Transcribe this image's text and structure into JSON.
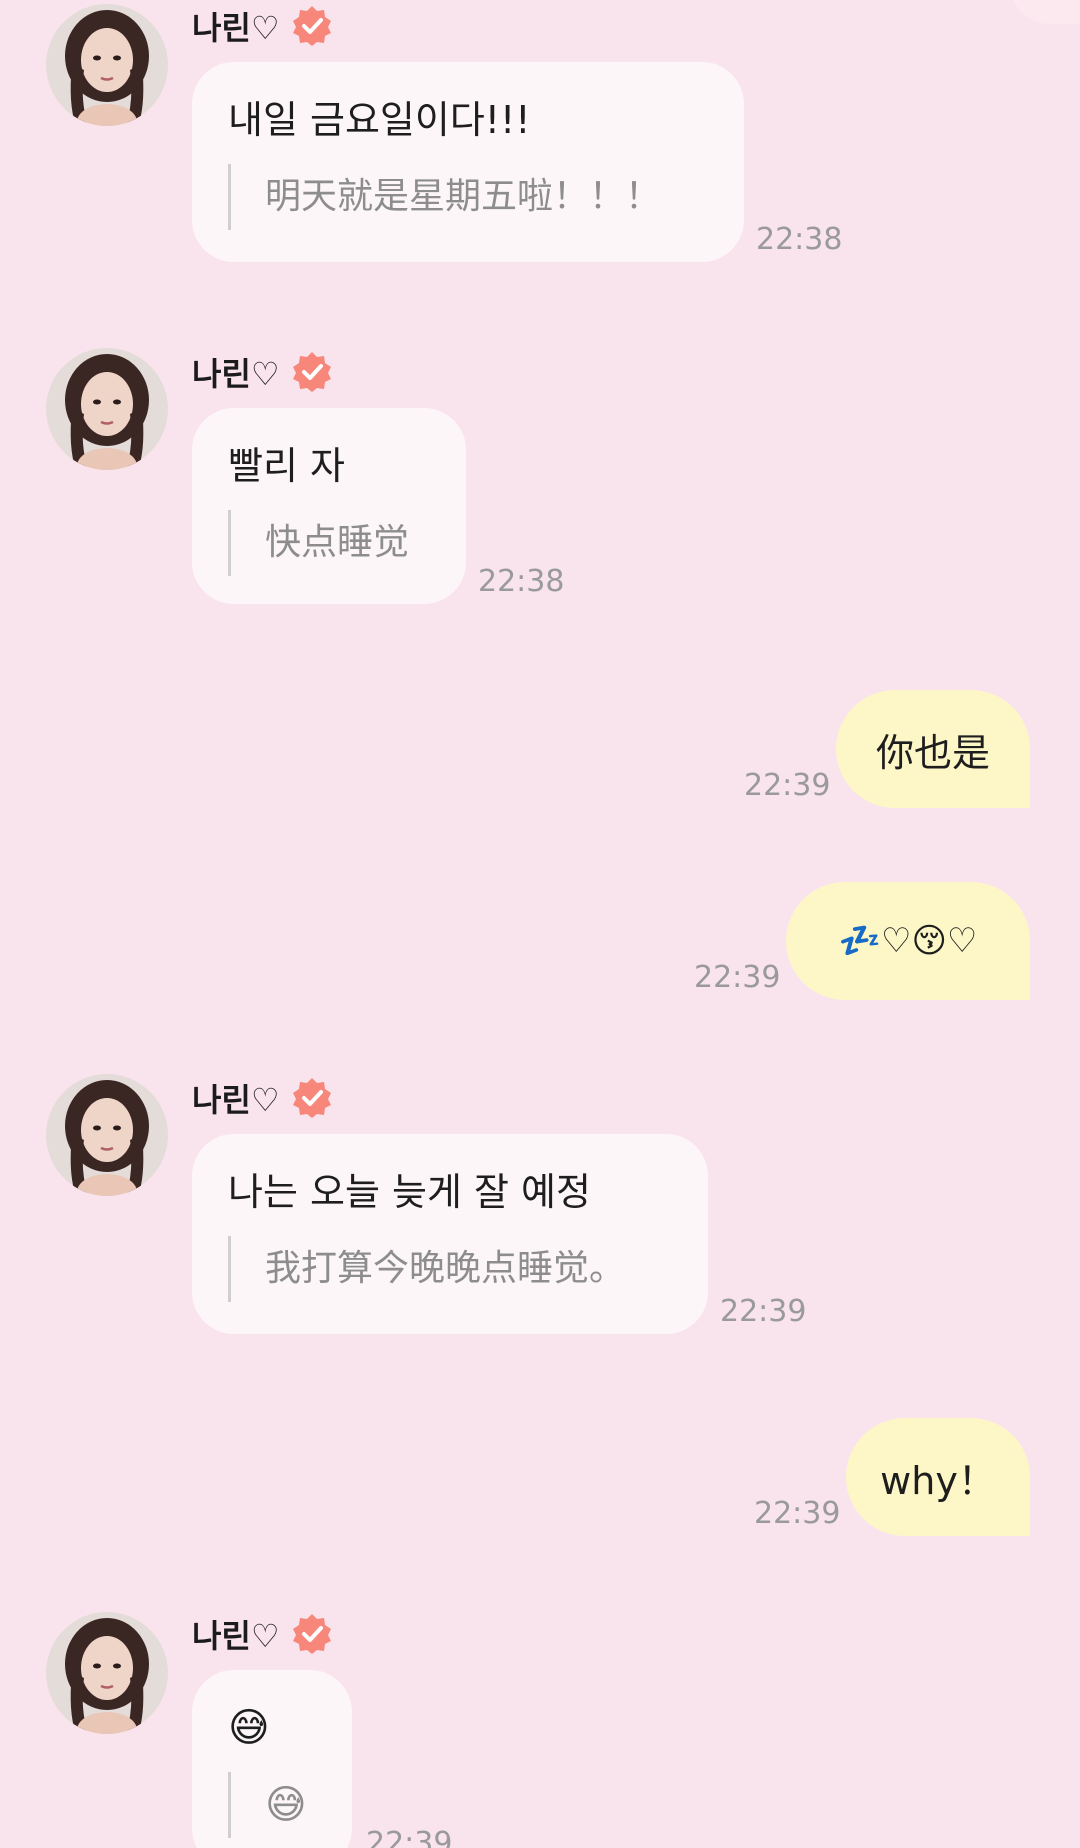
{
  "contact": {
    "name": "나린♡",
    "verified_icon": "verified-badge-icon",
    "accent": "#f6877a"
  },
  "messages": [
    {
      "text": "내일 금요일이다!!!",
      "translation": "明天就是星期五啦！！！",
      "time": "22:38"
    },
    {
      "text": "빨리 자",
      "translation": "快点睡觉",
      "time": "22:38"
    },
    {
      "text": "你也是",
      "time": "22:39"
    },
    {
      "text": "💤♡😚♡",
      "time": "22:39"
    },
    {
      "text": "나는 오늘 늦게 잘 예정",
      "translation": "我打算今晚晚点睡觉。",
      "time": "22:39"
    },
    {
      "text": "why！",
      "time": "22:39"
    },
    {
      "text": "😅",
      "translation": "😅",
      "time": "22:39"
    }
  ],
  "colors": {
    "background": "#f9e4ee",
    "incoming_bubble": "#fdf6f9",
    "outgoing_bubble": "#fdf7c8",
    "timestamp": "#9a9a9a"
  }
}
